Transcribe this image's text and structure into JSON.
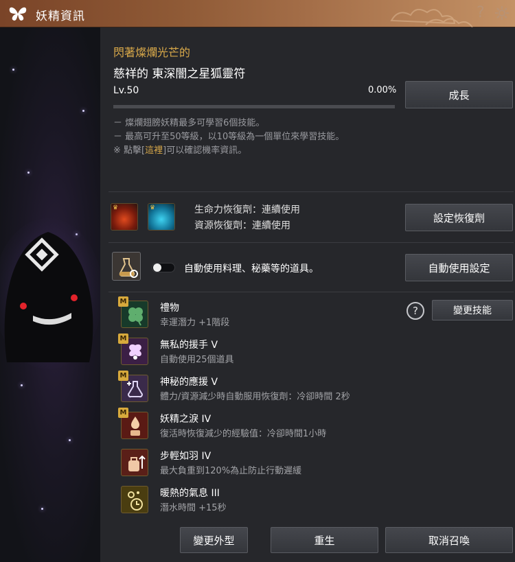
{
  "window": {
    "title": "妖精資訊",
    "help_glyph": "?",
    "settings_glyph": "✲"
  },
  "pet": {
    "name_prefix": "閃著燦爛光芒的",
    "name": "慈祥的 東深闇之星狐靈符",
    "level": "Lv.50",
    "exp_percent": "0.00%",
    "exp_fraction": 0.0
  },
  "buttons": {
    "grow": "成長",
    "set_potion": "設定恢復劑",
    "auto_use_settings": "自動使用設定",
    "change_skill": "變更技能",
    "change_look": "變更外型",
    "rebirth": "重生",
    "unsummon": "取消召喚"
  },
  "notes": {
    "line1": "－ 燦爛翅膀妖精最多可學習6個技能。",
    "line2": "－ 最高可升至50等級，以10等級為一個單位來學習技能。",
    "line3_pre": "※ 點擊[",
    "line3_link": "這裡",
    "line3_post": "]可以確認機率資訊。"
  },
  "potions": {
    "hp": "生命力恢復劑：連續使用",
    "mp": "資源恢復劑：連續使用"
  },
  "auto_use": {
    "label": "自動使用料理、秘藥等的道具。",
    "enabled": false
  },
  "skills": [
    {
      "name": "禮物",
      "desc": "幸運潛力 +1階段",
      "badge": "M",
      "icon": "clover-icon"
    },
    {
      "name": "無私的援手 V",
      "desc": "自動使用25個道具",
      "badge": "M",
      "icon": "fairy-icon"
    },
    {
      "name": "神秘的應援 V",
      "desc": "體力/資源減少時自動服用恢復劑：冷卻時間 2秒",
      "badge": "M",
      "icon": "potion-plus-icon"
    },
    {
      "name": "妖精之淚 IV",
      "desc": "復活時恢復減少的經驗值：冷卻時間1小時",
      "badge": "M",
      "icon": "tear-vase-icon"
    },
    {
      "name": "步輕如羽 IV",
      "desc": "最大負重到120%為止防止行動遲緩",
      "badge": "",
      "icon": "weight-bag-icon"
    },
    {
      "name": "暖熱的氣息 III",
      "desc": "潛水時間 +15秒",
      "badge": "",
      "icon": "bubble-timer-icon"
    }
  ],
  "colors": {
    "gold": "#d9a94a",
    "titlebar": "#8f5a36"
  }
}
